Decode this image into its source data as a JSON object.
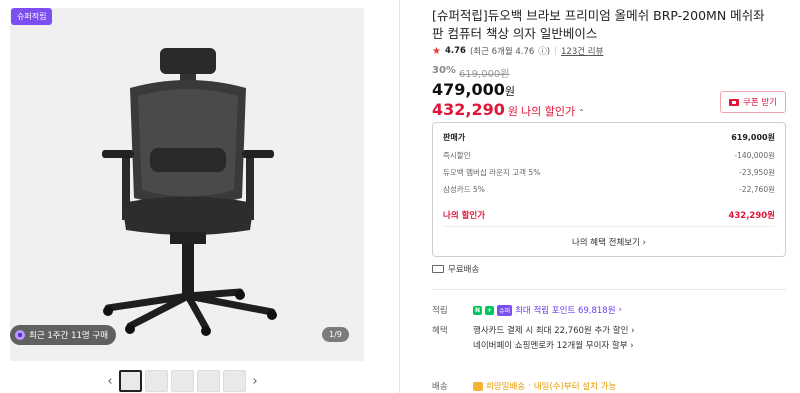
{
  "gallery": {
    "badge": "슈퍼적립",
    "recent": "최근 1주간 11명 구매",
    "pager": "1/9",
    "thumb_count": 5
  },
  "product": {
    "title": "[슈퍼적립]듀오백 브라보 프리미엄 올메쉬 BRP-200MN 메쉬좌판 컴퓨터 책상 의자 일반베이스",
    "rating": "4.76",
    "rating_detail": "(최근 6개월 4.76",
    "reviews": "123건 리뷰",
    "discount_pct": "30%",
    "original_price": "619,000원",
    "price": "479,000",
    "price_unit": "원",
    "my_price": "432,290",
    "my_price_unit": "원",
    "my_price_label": "나의 할인가",
    "coupon": "쿠폰 받기"
  },
  "breakdown": {
    "rows": [
      {
        "label": "판매가",
        "value": "619,000원"
      },
      {
        "label": "즉시할인",
        "value": "-140,000원"
      },
      {
        "label": "듀오백 멤버십 라운지 고객 5%",
        "value": "-23,950원"
      },
      {
        "label": "삼성카드 5%",
        "value": "-22,760원"
      }
    ],
    "total_label": "나의 할인가",
    "total_value": "432,290원",
    "more": "나의 혜택 전체보기"
  },
  "shipping": "무료배송",
  "points": {
    "label": "적립",
    "n_badge": "N",
    "plus": "+",
    "s_badge": "슈퍼",
    "text": "최대 적립 포인트 69,818원"
  },
  "benefits": {
    "label": "혜택",
    "items": [
      "행사카드 결제 시 최대 22,760원 추가 할인",
      "네이버페이 쇼핑멘로카 12개월 무이자 할부"
    ]
  },
  "delivery": {
    "label": "배송",
    "text": "희망일배송",
    "sub": "내일(수)부터 설치 가능"
  }
}
